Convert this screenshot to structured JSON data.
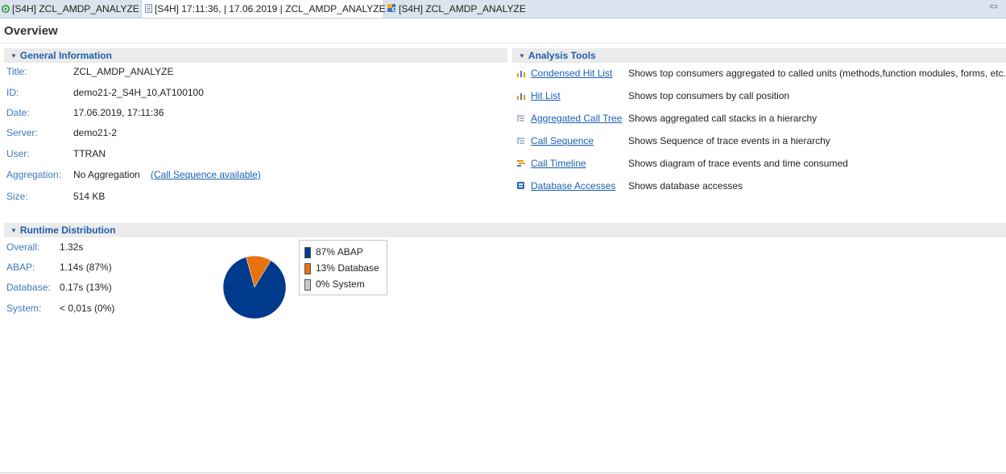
{
  "tabs": [
    {
      "label": "[S4H] ZCL_AMDP_ANALYZE",
      "icon": "green-object-icon"
    },
    {
      "label": "[S4H] 17:11:36, | 17.06.2019 | ZCL_AMDP_ANALYZE",
      "icon": "document-icon",
      "close": "×"
    },
    {
      "label": "[S4H] ZCL_AMDP_ANALYZE",
      "icon": "class-icon"
    }
  ],
  "page_title": "Overview",
  "general": {
    "header": "General Information",
    "rows": [
      {
        "label": "Title:",
        "value": "ZCL_AMDP_ANALYZE"
      },
      {
        "label": "ID:",
        "value": "demo21-2_S4H_10,AT100100"
      },
      {
        "label": "Date:",
        "value": "17.06.2019, 17:11:36"
      },
      {
        "label": "Server:",
        "value": "demo21-2"
      },
      {
        "label": "User:",
        "value": "TTRAN"
      },
      {
        "label": "Aggregation:",
        "value": "No Aggregation",
        "link": "(Call Sequence available)"
      },
      {
        "label": "Size:",
        "value": "514 KB"
      }
    ]
  },
  "tools": {
    "header": "Analysis Tools",
    "items": [
      {
        "link": "Condensed Hit List",
        "desc": "Shows top consumers aggregated to called units (methods,function modules, forms, etc.",
        "icon": "bar-chart-icon"
      },
      {
        "link": "Hit List",
        "desc": "Shows top consumers by call position",
        "icon": "bar-chart-icon"
      },
      {
        "link": "Aggregated Call Tree",
        "desc": "Shows aggregated call stacks in a hierarchy",
        "icon": "tree-icon"
      },
      {
        "link": "Call Sequence",
        "desc": "Shows Sequence of trace events in a hierarchy",
        "icon": "tree-icon"
      },
      {
        "link": "Call Timeline",
        "desc": "Shows diagram of trace events and time consumed",
        "icon": "timeline-icon"
      },
      {
        "link": "Database Accesses",
        "desc": "Shows database accesses",
        "icon": "database-icon"
      }
    ]
  },
  "runtime": {
    "header": "Runtime Distribution",
    "rows": [
      {
        "label": "Overall:",
        "value": "1.32s"
      },
      {
        "label": "ABAP:",
        "value": "1.14s (87%)"
      },
      {
        "label": "Database:",
        "value": "0.17s (13%)"
      },
      {
        "label": "System:",
        "value": "< 0,01s (0%)"
      }
    ]
  },
  "chart_data": {
    "type": "pie",
    "categories": [
      "ABAP",
      "Database",
      "System"
    ],
    "values": [
      87,
      13,
      0
    ],
    "legend": [
      "87% ABAP",
      "13% Database",
      "0% System"
    ],
    "colors": [
      "#003a8c",
      "#e6730f",
      "#c8c8c8"
    ],
    "legend_position": "right"
  }
}
